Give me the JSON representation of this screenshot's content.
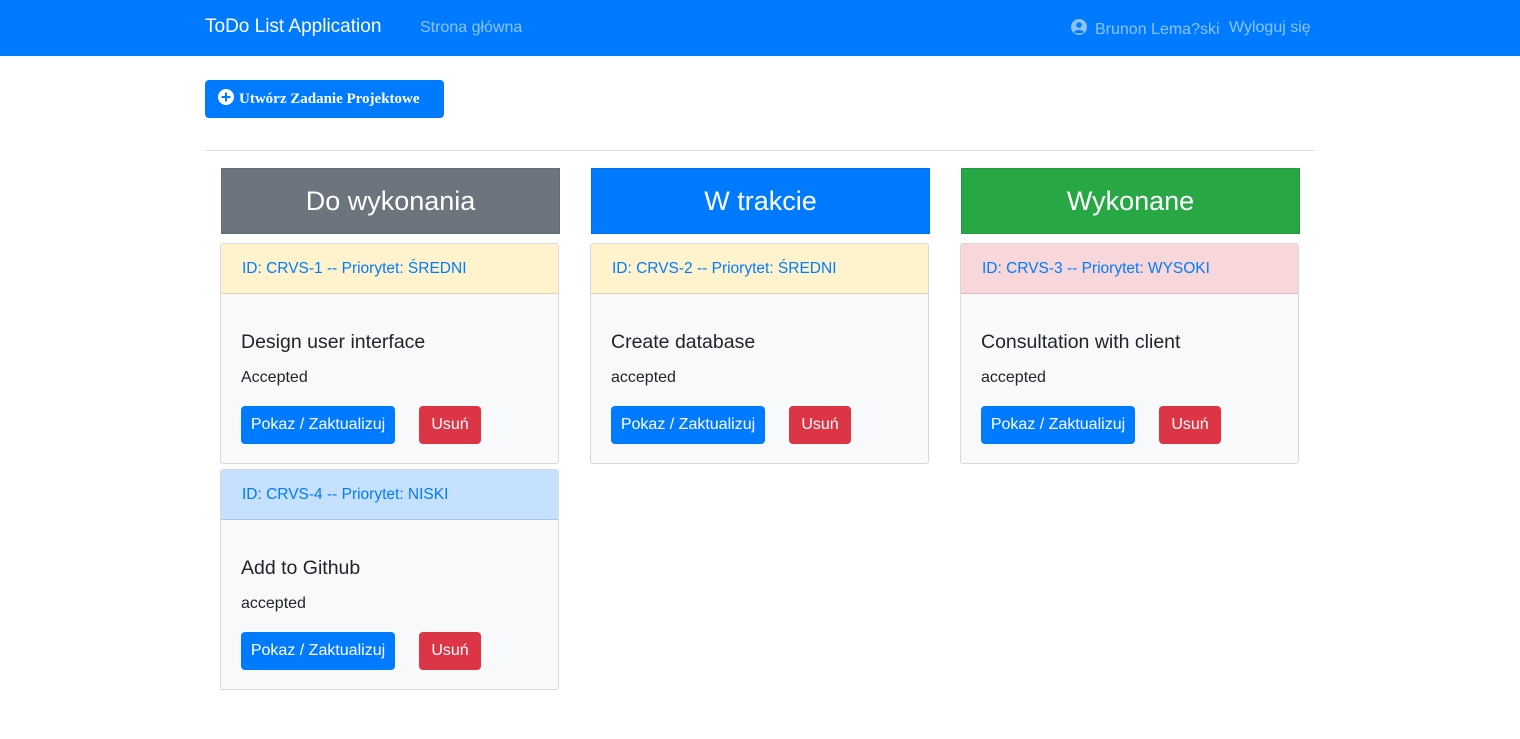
{
  "navbar": {
    "brand": "ToDo List Application",
    "home_link": "Strona główna",
    "user_name": "Brunon Lema?ski",
    "user_icon": "user-circle-icon",
    "logout_link": "Wyloguj się",
    "bg_color": "#007bff"
  },
  "toolbar": {
    "create_label": "Utwórz Zadanie Projektowe",
    "create_icon": "plus-circle-icon"
  },
  "columns": [
    {
      "title": "Do wykonania",
      "color": "#6c757d"
    },
    {
      "title": "W trakcie",
      "color": "#007bff"
    },
    {
      "title": "Wykonane",
      "color": "#28a745"
    }
  ],
  "cards": [
    {
      "header": "ID: CRVS-1 -- Priorytet: ŚREDNI",
      "header_color": "#fff3cd",
      "title": "Design user interface",
      "status": "Accepted",
      "show_label": "Pokaz / Zaktualizuj",
      "delete_label": "Usuń"
    },
    {
      "header": "ID: CRVS-4 -- Priorytet: NISKI",
      "header_color": "#cce5ff",
      "title": "Add to Github",
      "status": "accepted",
      "show_label": "Pokaz / Zaktualizuj",
      "delete_label": "Usuń"
    },
    {
      "header": "ID: CRVS-2 -- Priorytet: ŚREDNI",
      "header_color": "#fff3cd",
      "title": "Create database",
      "status": "accepted",
      "show_label": "Pokaz / Zaktualizuj",
      "delete_label": "Usuń"
    },
    {
      "header": "ID: CRVS-3 -- Priorytet: WYSOKI",
      "header_color": "#f8d7da",
      "title": "Consultation with client",
      "status": "accepted",
      "show_label": "Pokaz / Zaktualizuj",
      "delete_label": "Usuń"
    }
  ]
}
